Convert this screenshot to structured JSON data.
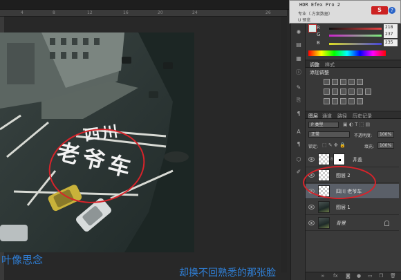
{
  "ruler": {
    "ticks": [
      "4",
      "8",
      "12",
      "16",
      "20",
      "24",
      "26"
    ]
  },
  "hdr_popup": {
    "title": "HDR Efex Pro 2",
    "line1": "专业（.方案数据）",
    "line2": "U 预览"
  },
  "badges": {
    "app_badge": "S",
    "help": "?"
  },
  "color_panel": {
    "sliders": [
      {
        "label": "R",
        "value": "218",
        "gradient": "linear-gradient(90deg,#111,#e44)"
      },
      {
        "label": "G",
        "value": "237",
        "gradient": "linear-gradient(90deg,#c2c,#7e7)"
      },
      {
        "label": "B",
        "value": "235",
        "gradient": "linear-gradient(90deg,#dd2,#44d)"
      }
    ]
  },
  "adjust_panel": {
    "tabs": [
      "调整",
      "样式"
    ],
    "title": "添加调整"
  },
  "layers_panel": {
    "tabs": [
      "图层",
      "通道",
      "路径",
      "历史记录"
    ],
    "filter_label": "P 类型",
    "blend_mode": "正常",
    "opacity_label": "不透明度:",
    "opacity_value": "100%",
    "lock_label": "锁定:",
    "fill_label": "填充:",
    "fill_value": "100%",
    "layers": [
      {
        "name": "井盖",
        "type": "masked",
        "selected": false
      },
      {
        "name": "图层 2",
        "type": "empty",
        "selected": false
      },
      {
        "name": "四川 老爷车",
        "type": "text",
        "selected": true
      },
      {
        "name": "图层 1",
        "type": "photo",
        "selected": false
      },
      {
        "name": "背景",
        "type": "photo",
        "selected": false,
        "locked": true
      }
    ],
    "bottom_icons": [
      "∞",
      "fx",
      "◙",
      "●",
      "▭",
      "❐",
      "🗑"
    ]
  },
  "canvas_text": {
    "line1": "四川",
    "line2": "老爷车"
  },
  "lyrics": {
    "left": "叶像思念",
    "right": "却换不回熟悉的那张脸"
  },
  "colors": {
    "accent_ring": "#d8232a",
    "lyric": "#2f7fd6"
  }
}
